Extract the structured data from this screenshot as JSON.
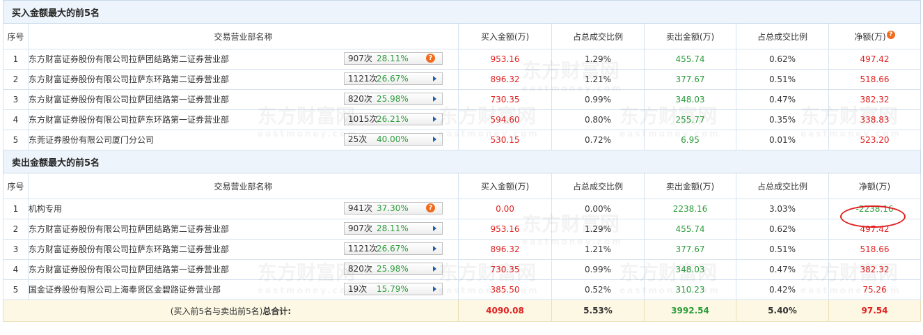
{
  "buy_section": {
    "title": "买入金额最大的前5名",
    "headers": [
      "序号",
      "交易营业部名称",
      "买入金额(万)",
      "占总成交比例",
      "卖出金额(万)",
      "占总成交比例",
      "净额(万)"
    ],
    "rows": [
      {
        "rank": "1",
        "name": "东方财富证券股份有限公司拉萨团结路第二证券营业部",
        "count": "907次",
        "rate": "28.11%",
        "icon": "warning-icon",
        "buy": "953.16",
        "buy_pct": "1.29%",
        "sell": "455.74",
        "sell_pct": "0.62%",
        "net": "497.42"
      },
      {
        "rank": "2",
        "name": "东方财富证券股份有限公司拉萨东环路第二证券营业部",
        "count": "1121次",
        "rate": "26.67%",
        "icon": "arrow-right-icon",
        "buy": "896.32",
        "buy_pct": "1.21%",
        "sell": "377.67",
        "sell_pct": "0.51%",
        "net": "518.66"
      },
      {
        "rank": "3",
        "name": "东方财富证券股份有限公司拉萨团结路第一证券营业部",
        "count": "820次",
        "rate": "25.98%",
        "icon": "arrow-right-icon",
        "buy": "730.35",
        "buy_pct": "0.99%",
        "sell": "348.03",
        "sell_pct": "0.47%",
        "net": "382.32"
      },
      {
        "rank": "4",
        "name": "东方财富证券股份有限公司拉萨东环路第一证券营业部",
        "count": "1015次",
        "rate": "26.21%",
        "icon": "arrow-right-icon",
        "buy": "594.60",
        "buy_pct": "0.80%",
        "sell": "255.77",
        "sell_pct": "0.35%",
        "net": "338.83"
      },
      {
        "rank": "5",
        "name": "东莞证券股份有限公司厦门分公司",
        "count": "25次",
        "rate": "40.00%",
        "icon": "arrow-right-icon",
        "buy": "530.15",
        "buy_pct": "0.72%",
        "sell": "6.95",
        "sell_pct": "0.01%",
        "net": "523.20"
      }
    ]
  },
  "sell_section": {
    "title": "卖出金额最大的前5名",
    "headers": [
      "序号",
      "交易营业部名称",
      "买入金额(万)",
      "占总成交比例",
      "卖出金额(万)",
      "占总成交比例",
      "净额(万)"
    ],
    "rows": [
      {
        "rank": "1",
        "name": "机构专用",
        "count": "941次",
        "rate": "37.30%",
        "icon": "warning-icon",
        "buy": "0.00",
        "buy_pct": "0.00%",
        "sell": "2238.16",
        "sell_pct": "3.03%",
        "net": "-2238.16"
      },
      {
        "rank": "2",
        "name": "东方财富证券股份有限公司拉萨团结路第二证券营业部",
        "count": "907次",
        "rate": "28.11%",
        "icon": "arrow-right-icon",
        "buy": "953.16",
        "buy_pct": "1.29%",
        "sell": "455.74",
        "sell_pct": "0.62%",
        "net": "497.42"
      },
      {
        "rank": "3",
        "name": "东方财富证券股份有限公司拉萨东环路第二证券营业部",
        "count": "1121次",
        "rate": "26.67%",
        "icon": "arrow-right-icon",
        "buy": "896.32",
        "buy_pct": "1.21%",
        "sell": "377.67",
        "sell_pct": "0.51%",
        "net": "518.66"
      },
      {
        "rank": "4",
        "name": "东方财富证券股份有限公司拉萨团结路第一证券营业部",
        "count": "820次",
        "rate": "25.98%",
        "icon": "arrow-right-icon",
        "buy": "730.35",
        "buy_pct": "0.99%",
        "sell": "348.03",
        "sell_pct": "0.47%",
        "net": "382.32"
      },
      {
        "rank": "5",
        "name": "国金证券股份有限公司上海奉贤区金碧路证券营业部",
        "count": "19次",
        "rate": "15.79%",
        "icon": "arrow-right-icon",
        "buy": "385.50",
        "buy_pct": "0.52%",
        "sell": "310.23",
        "sell_pct": "0.42%",
        "net": "75.26"
      }
    ]
  },
  "total": {
    "label_prefix": "(买入前5名与卖出前5名)",
    "label_bold": "总合计:",
    "buy": "4090.08",
    "buy_pct": "5.53%",
    "sell": "3992.54",
    "sell_pct": "5.40%",
    "net": "97.54"
  },
  "watermark": {
    "cn": "东方财富网",
    "en": "eastmoney.com"
  },
  "colors": {
    "positive": "#e02020",
    "negative": "#2b9b3a",
    "badge_pct": "#2b9b3a",
    "warning": "#f26b1d",
    "arrow": "#1f5fa8",
    "header_bg": "#eef4fb",
    "total_bg": "#fdf8e4",
    "highlight_circle": "#e02020"
  }
}
